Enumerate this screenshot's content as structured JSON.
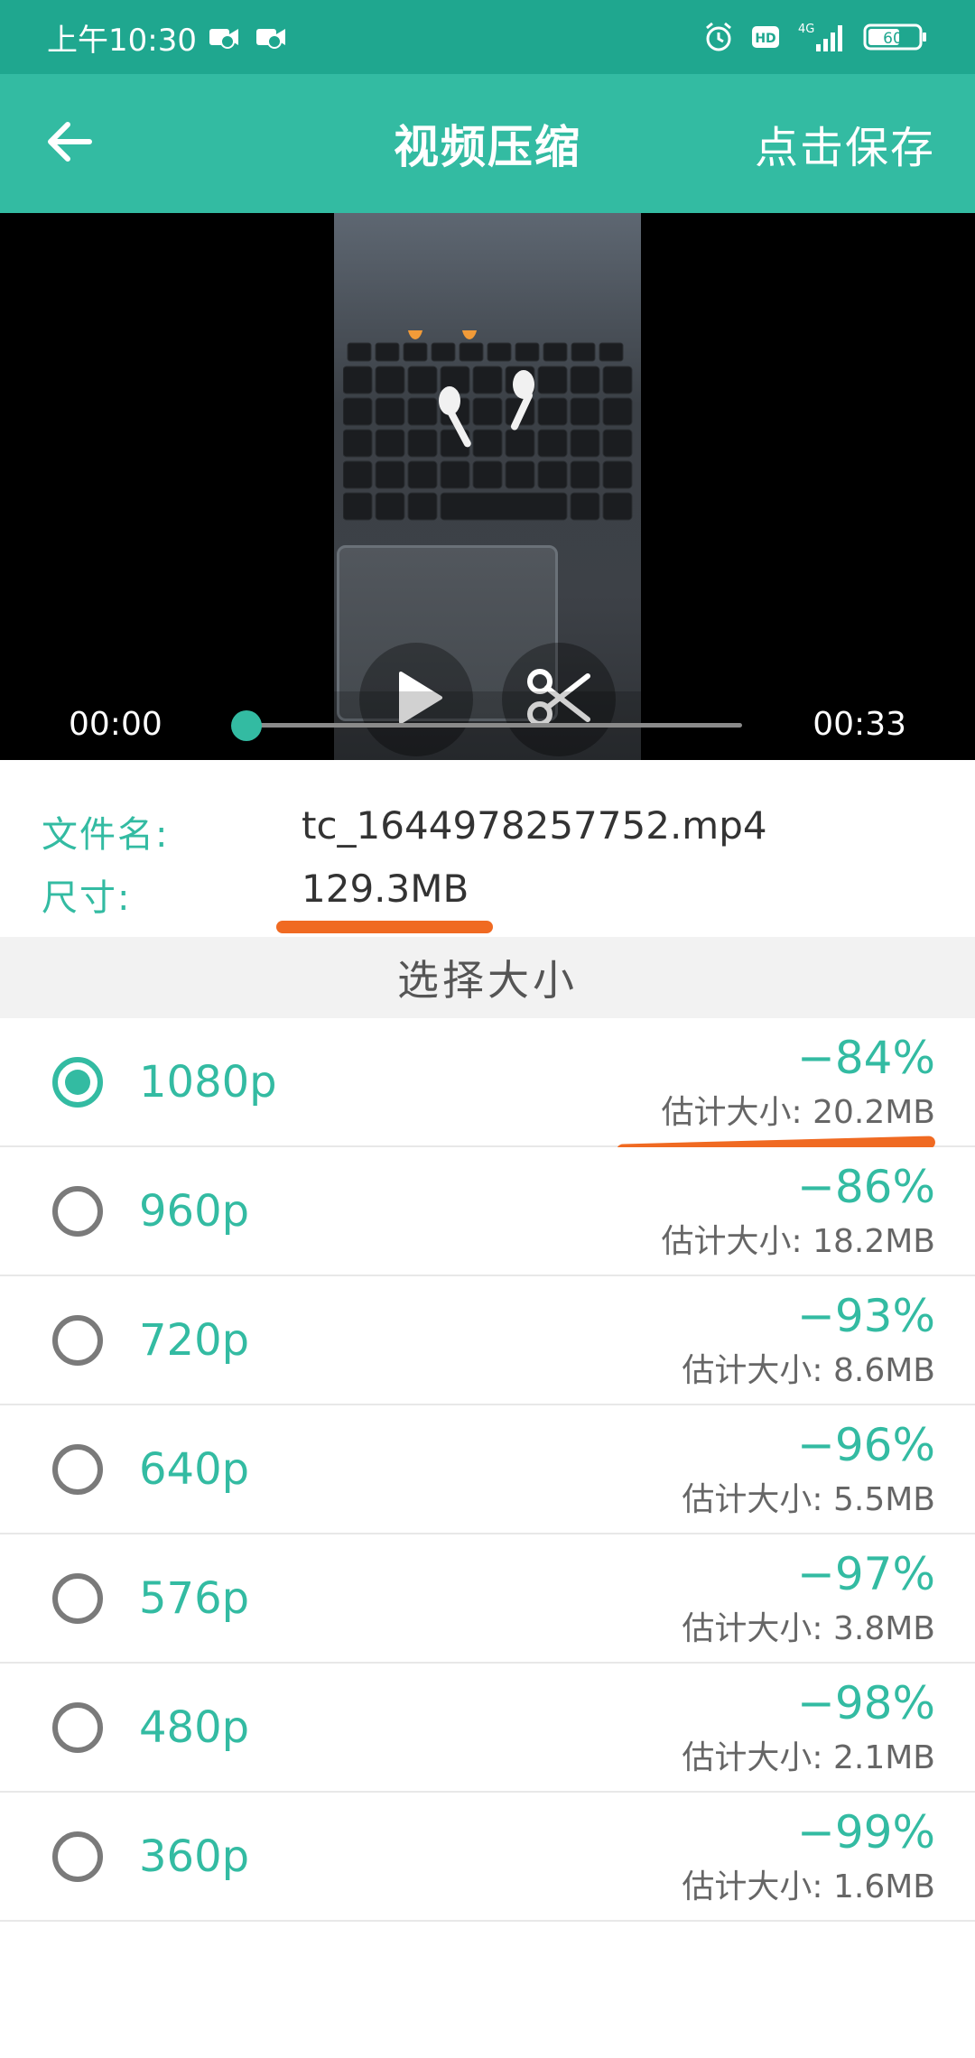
{
  "status_bar": {
    "time": "上午10:30",
    "network": "4G",
    "hd": "HD",
    "battery": "60",
    "icons": [
      "video-notification-icon",
      "video-notification-icon",
      "alarm-icon",
      "hd-icon",
      "signal-icon",
      "battery-icon"
    ]
  },
  "header": {
    "title": "视频压缩",
    "save_label": "点击保存",
    "back_icon": "arrow-left-icon"
  },
  "video": {
    "current_time": "00:00",
    "total_time": "00:33",
    "progress": 0,
    "overlay_icons": [
      "play-icon",
      "scissors-icon"
    ]
  },
  "file_info": {
    "name_label": "文件名:",
    "name_value": "tc_1644978257752.mp4",
    "size_label": "尺寸:",
    "size_value": "129.3MB"
  },
  "section": {
    "title": "选择大小"
  },
  "options": [
    {
      "resolution": "1080p",
      "reduction": "−84%",
      "estimate": "估计大小: 20.2MB",
      "selected": true
    },
    {
      "resolution": "960p",
      "reduction": "−86%",
      "estimate": "估计大小: 18.2MB",
      "selected": false
    },
    {
      "resolution": "720p",
      "reduction": "−93%",
      "estimate": "估计大小: 8.6MB",
      "selected": false
    },
    {
      "resolution": "640p",
      "reduction": "−96%",
      "estimate": "估计大小: 5.5MB",
      "selected": false
    },
    {
      "resolution": "576p",
      "reduction": "−97%",
      "estimate": "估计大小: 3.8MB",
      "selected": false
    },
    {
      "resolution": "480p",
      "reduction": "−98%",
      "estimate": "估计大小: 2.1MB",
      "selected": false
    },
    {
      "resolution": "360p",
      "reduction": "−99%",
      "estimate": "估计大小: 1.6MB",
      "selected": false
    }
  ],
  "colors": {
    "status_bar": "#1FA78F",
    "accent": "#33BBA2",
    "highlight": "#F06A22"
  }
}
